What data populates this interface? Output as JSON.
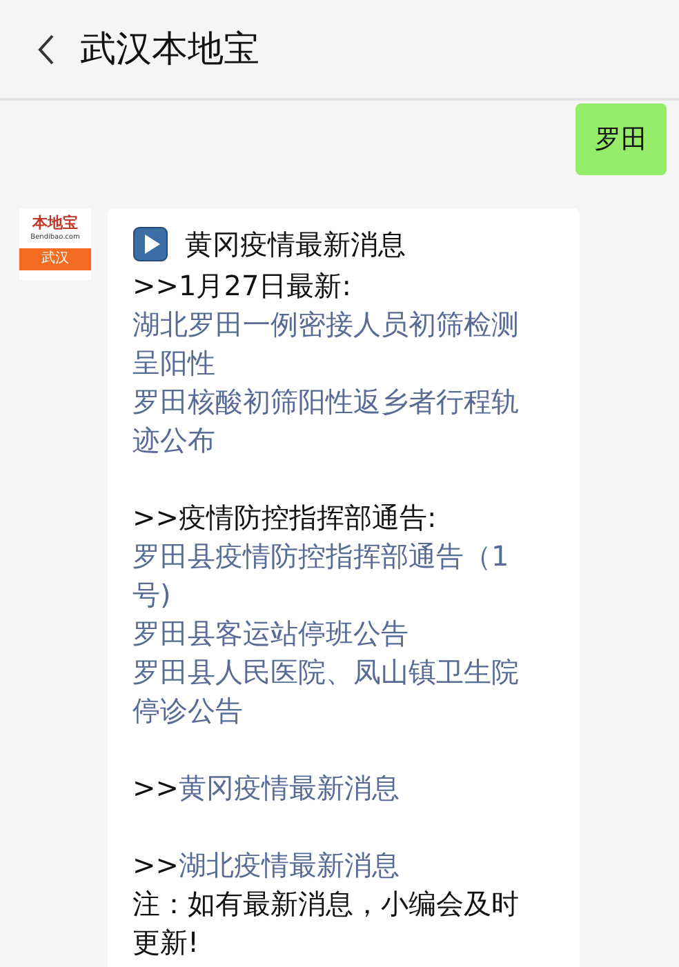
{
  "header": {
    "title": "武汉本地宝"
  },
  "messages": [
    {
      "kind": "sent",
      "text": "罗田"
    },
    {
      "kind": "received",
      "avatar": {
        "brand": "本地宝",
        "site": "Bendibao.com",
        "city": "武汉"
      },
      "heading": "黄冈疫情最新消息",
      "lines": [
        {
          "kind": "text",
          "text": ">>1月27日最新:"
        },
        {
          "kind": "link",
          "text": "湖北罗田一例密接人员初筛检测呈阳性"
        },
        {
          "kind": "link",
          "text": "罗田核酸初筛阳性返乡者行程轨迹公布"
        },
        {
          "kind": "gap"
        },
        {
          "kind": "text",
          "text": ">>疫情防控指挥部通告:"
        },
        {
          "kind": "link",
          "text": "罗田县疫情防控指挥部通告（1号)"
        },
        {
          "kind": "link",
          "text": "罗田县客运站停班公告"
        },
        {
          "kind": "link",
          "text": "罗田县人民医院、凤山镇卫生院停诊公告"
        },
        {
          "kind": "gap"
        },
        {
          "kind": "prefixed_link",
          "prefix": ">>",
          "text": "黄冈疫情最新消息"
        },
        {
          "kind": "gap"
        },
        {
          "kind": "prefixed_link",
          "prefix": ">>",
          "text": "湖北疫情最新消息"
        },
        {
          "kind": "text",
          "text": "注：如有最新消息，小编会及时更新!"
        }
      ]
    }
  ]
}
